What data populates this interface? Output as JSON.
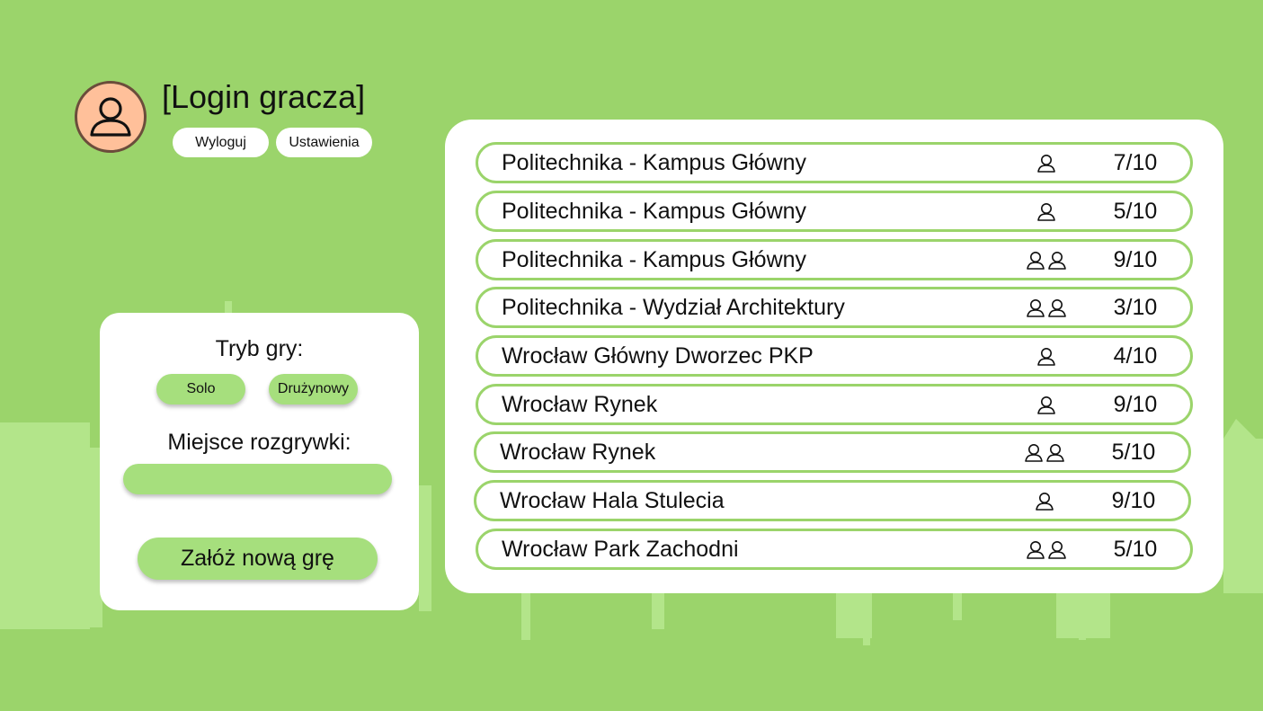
{
  "user": {
    "login": "[Login gracza]",
    "logout_label": "Wyloguj",
    "settings_label": "Ustawienia"
  },
  "create_panel": {
    "mode_title": "Tryb gry:",
    "solo_label": "Solo",
    "team_label": "Drużynowy",
    "place_title": "Miejsce rozgrywki:",
    "place_value": "",
    "create_label": "Załóż nową grę"
  },
  "games": [
    {
      "name": "Politechnika - Kampus Główny",
      "mode": "solo",
      "mode_icon": "single-user-icon",
      "players": "7/10"
    },
    {
      "name": "Politechnika - Kampus Główny",
      "mode": "solo",
      "mode_icon": "single-user-icon",
      "players": "5/10"
    },
    {
      "name": "Politechnika - Kampus Główny",
      "mode": "team",
      "mode_icon": "two-users-icon",
      "players": "9/10"
    },
    {
      "name": "Politechnika - Wydział Architektury",
      "mode": "team",
      "mode_icon": "two-users-icon",
      "players": "3/10"
    },
    {
      "name": "Wrocław Główny Dworzec PKP",
      "mode": "solo",
      "mode_icon": "single-user-icon",
      "players": "4/10"
    },
    {
      "name": "Wrocław Rynek",
      "mode": "solo",
      "mode_icon": "single-user-icon",
      "players": "9/10"
    },
    {
      "name": "Wrocław Rynek",
      "mode": "team",
      "mode_icon": "two-users-icon",
      "players": "5/10"
    },
    {
      "name": "Wrocław Hala Stulecia",
      "mode": "solo",
      "mode_icon": "single-user-icon",
      "players": "9/10"
    },
    {
      "name": "Wrocław Park Zachodni",
      "mode": "team",
      "mode_icon": "two-users-icon",
      "players": "5/10"
    }
  ],
  "colors": {
    "background": "#9bd46b",
    "skyline": "#b3e58a",
    "accent_button": "#a6df7d",
    "avatar_fill": "#ffc09a",
    "avatar_border": "#6b4d3b"
  }
}
